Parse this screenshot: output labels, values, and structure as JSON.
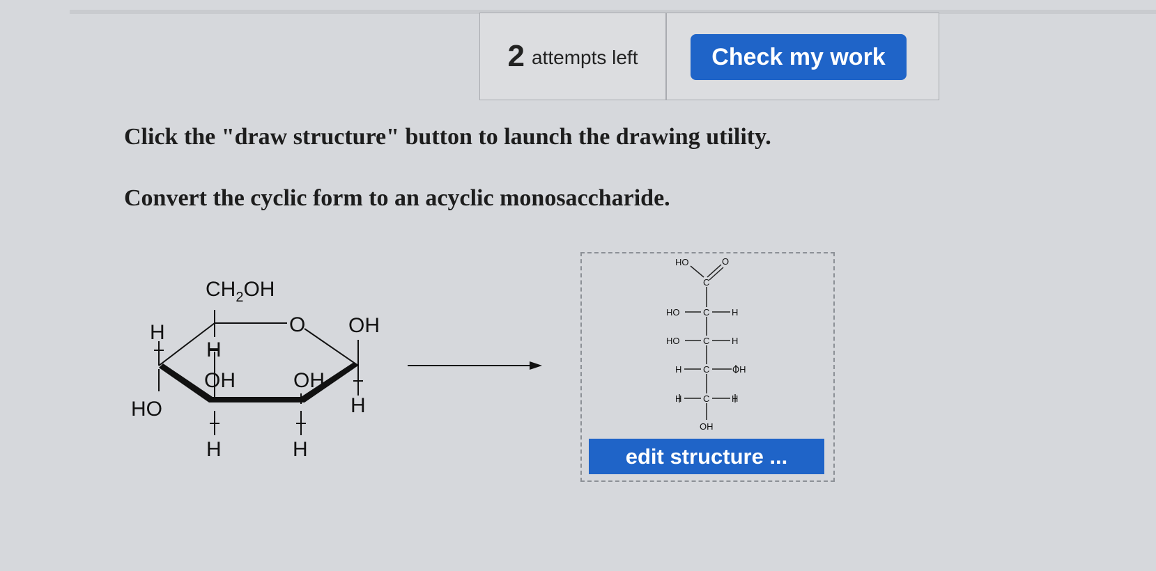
{
  "attempts": {
    "count": "2",
    "label": "attempts left"
  },
  "check_button": "Check my work",
  "instructions": [
    "Click the \"draw structure\" button to launch the drawing utility.",
    "Convert the cyclic form to an acyclic monosaccharide."
  ],
  "cyclic": {
    "ch2oh": "CH",
    "ch2oh_sub": "2",
    "ch2oh_tail": "OH",
    "ring_o": "O",
    "c1_oh": "OH",
    "c1_h": "H",
    "c2_oh": "OH",
    "c2_h": "H",
    "c3_oh": "OH",
    "c3_h": "H",
    "c4_h_top": "H",
    "c4_ho": "HO",
    "c5_h": "H",
    "c4_h_small": "H"
  },
  "acyclic": {
    "top_ho": "HO",
    "top_o": "O",
    "top_c": "C",
    "rows": [
      {
        "left": "HO",
        "center": "C",
        "right": "H"
      },
      {
        "left": "HO",
        "center": "C",
        "right": "H"
      },
      {
        "left": "H",
        "center": "C",
        "right": "OH"
      },
      {
        "left": "H",
        "center": "C",
        "right": "H"
      }
    ],
    "bottom": "OH"
  },
  "edit_button": "edit structure ..."
}
